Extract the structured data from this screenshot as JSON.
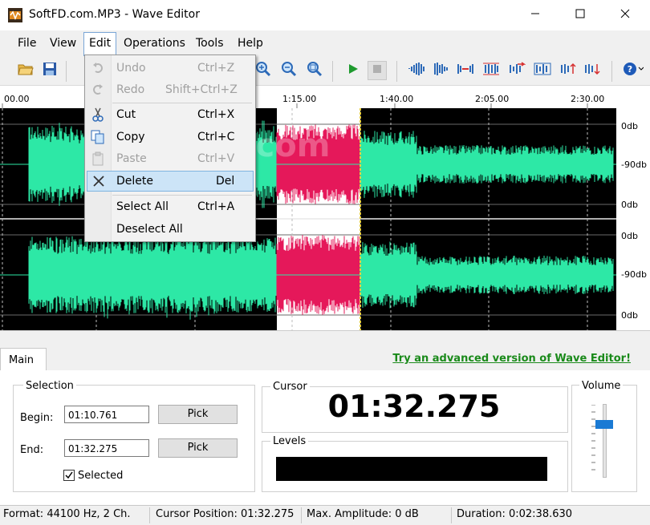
{
  "window": {
    "title": "SoftFD.com.MP3 - Wave Editor",
    "app_icon": "wave-editor-app-icon",
    "minimize_icon": "minimize-icon",
    "maximize_icon": "maximize-icon",
    "close_icon": "close-icon"
  },
  "menubar": {
    "items": [
      "File",
      "View",
      "Edit",
      "Operations",
      "Tools",
      "Help"
    ]
  },
  "edit_menu": {
    "items": [
      {
        "label": "Undo",
        "shortcut": "Ctrl+Z",
        "enabled": false,
        "icon": "undo-icon"
      },
      {
        "label": "Redo",
        "shortcut": "Shift+Ctrl+Z",
        "enabled": false,
        "icon": "redo-icon"
      },
      {
        "label": "Cut",
        "shortcut": "Ctrl+X",
        "enabled": true,
        "icon": "scissors-icon"
      },
      {
        "label": "Copy",
        "shortcut": "Ctrl+C",
        "enabled": true,
        "icon": "copy-icon"
      },
      {
        "label": "Paste",
        "shortcut": "Ctrl+V",
        "enabled": false,
        "icon": "paste-icon"
      },
      {
        "label": "Delete",
        "shortcut": "Del",
        "enabled": true,
        "icon": "delete-x-icon",
        "highlighted": true
      },
      {
        "label": "Select All",
        "shortcut": "Ctrl+A",
        "enabled": true
      },
      {
        "label": "Deselect All",
        "shortcut": "",
        "enabled": true
      }
    ]
  },
  "timeline": {
    "ticks": [
      "00.00",
      "1:15.00",
      "1:40.00",
      "2:05.00",
      "2:30.00"
    ]
  },
  "db_scale": {
    "labels": [
      "0db",
      "-90db",
      "0db",
      "0db",
      "-90db",
      "0db"
    ]
  },
  "watermark": "SoftFD.com",
  "colors": {
    "wave": "#2de8a6",
    "wave_selected": "#e5185a",
    "selection_bg": "#ffffff",
    "promo": "#1a8a1a",
    "volume_thumb": "#1a7ad4"
  },
  "tabs": {
    "main": "Main"
  },
  "promo_link": "Try an advanced version of Wave Editor!",
  "selection": {
    "title": "Selection",
    "begin_label": "Begin:",
    "begin_value": "01:10.761",
    "end_label": "End:",
    "end_value": "01:32.275",
    "pick_label": "Pick",
    "selected_label": "Selected",
    "selected_checked": true
  },
  "cursor": {
    "title": "Cursor",
    "time": "01:32.275"
  },
  "levels": {
    "title": "Levels"
  },
  "volume": {
    "title": "Volume",
    "level": 0.75
  },
  "status": {
    "format": "Format: 44100 Hz, 2 Ch.",
    "cursor_position": "Cursor Position: 01:32.275",
    "max_amplitude": "Max. Amplitude: 0 dB",
    "duration": "Duration: 0:02:38.630"
  }
}
